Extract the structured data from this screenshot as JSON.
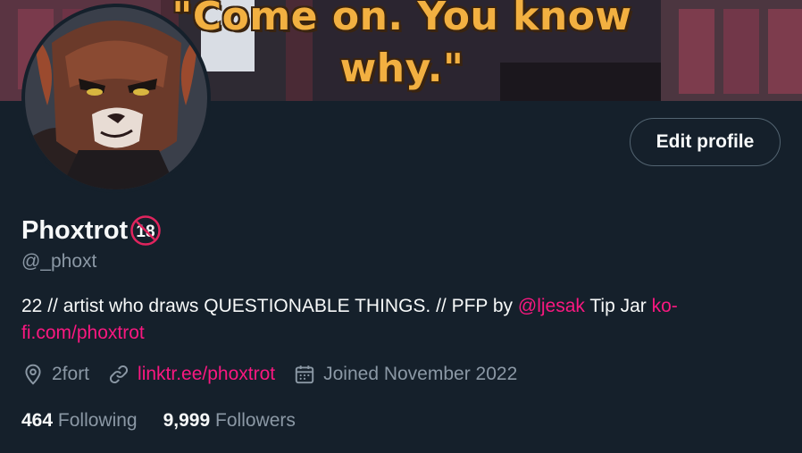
{
  "banner": {
    "quote_line1": "\"Come on. You know",
    "quote_line2": "why.\""
  },
  "profile": {
    "display_name": "Phoxtrot",
    "badge_text": "18",
    "handle": "@_phoxt",
    "edit_label": "Edit profile",
    "bio": {
      "text1": "22 // artist who draws QUESTIONABLE THINGS. // PFP by ",
      "mention": "@ljesak",
      "text2": " Tip Jar ",
      "link": "ko-fi.com/phoxtrot",
      "link_line1": "ko-",
      "link_line2": "fi.com/phoxtrot"
    },
    "location": "2fort",
    "website": "linktr.ee/phoxtrot",
    "joined": "Joined November 2022",
    "following_count": "464",
    "following_label": "Following",
    "followers_count": "9,999",
    "followers_label": "Followers"
  },
  "icons": {
    "location": "location-pin-icon",
    "link": "link-icon",
    "calendar": "calendar-icon",
    "badge": "no-under-18-icon"
  },
  "colors": {
    "background": "#15202b",
    "accent_link": "#f91880",
    "secondary_text": "#8b98a5",
    "primary_text": "#f7f9f9",
    "border": "#536471"
  }
}
